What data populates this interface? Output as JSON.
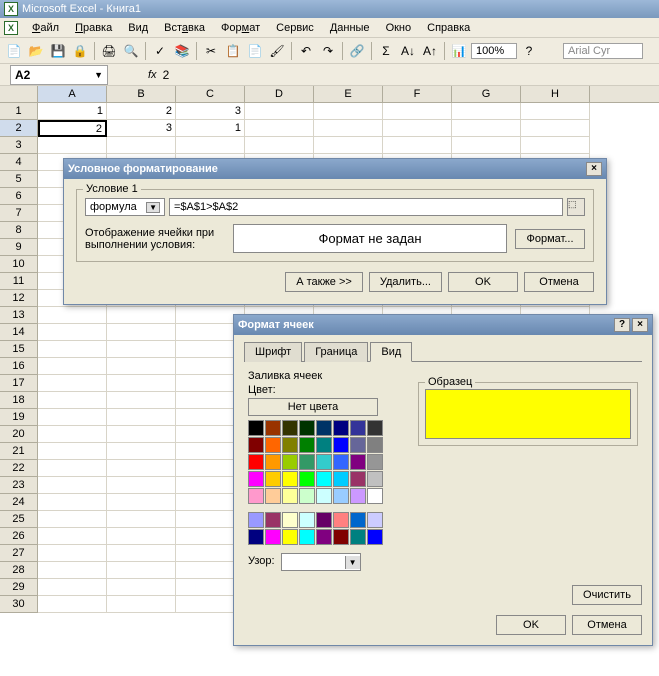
{
  "app": {
    "title": "Microsoft Excel - Книга1"
  },
  "menu": {
    "file": "Файл",
    "edit": "Правка",
    "view": "Вид",
    "insert": "Вставка",
    "format": "Формат",
    "tools": "Сервис",
    "data": "Данные",
    "window": "Окно",
    "help": "Справка"
  },
  "toolbar": {
    "zoom": "100%",
    "font": "Arial Cyr"
  },
  "namebox": {
    "ref": "A2",
    "fx": "fx",
    "formula": "2"
  },
  "columns": [
    "A",
    "B",
    "C",
    "D",
    "E",
    "F",
    "G",
    "H"
  ],
  "rows": [
    "1",
    "2",
    "3",
    "4",
    "5",
    "6",
    "7",
    "8",
    "9",
    "10",
    "11",
    "12",
    "13",
    "14",
    "15",
    "16",
    "17",
    "18",
    "19",
    "20",
    "21",
    "22",
    "23",
    "24",
    "25",
    "26",
    "27",
    "28",
    "29",
    "30"
  ],
  "cells": {
    "A1": "1",
    "B1": "2",
    "C1": "3",
    "A2": "2",
    "B2": "3",
    "C2": "1"
  },
  "cf_dialog": {
    "title": "Условное форматирование",
    "group": "Условие 1",
    "dropdown": "формула",
    "formula": "=$A$1>$A$2",
    "display_label": "Отображение ячейки при выполнении условия:",
    "preview": "Формат не задан",
    "format_btn": "Формат...",
    "also_btn": "А также >>",
    "delete_btn": "Удалить...",
    "ok_btn": "OK",
    "cancel_btn": "Отмена"
  },
  "fc_dialog": {
    "title": "Формат ячеек",
    "tab_font": "Шрифт",
    "tab_border": "Граница",
    "tab_view": "Вид",
    "fill_label": "Заливка ячеек",
    "color_label": "Цвет:",
    "nocolor": "Нет цвета",
    "pattern_label": "Узор:",
    "sample_label": "Образец",
    "sample_color": "#ffff00",
    "clear_btn": "Очистить",
    "ok_btn": "OK",
    "cancel_btn": "Отмена"
  },
  "palette1": [
    "#000000",
    "#993300",
    "#333300",
    "#003300",
    "#003366",
    "#000080",
    "#333399",
    "#333333",
    "#800000",
    "#ff6600",
    "#808000",
    "#008000",
    "#008080",
    "#0000ff",
    "#666699",
    "#808080",
    "#ff0000",
    "#ff9900",
    "#99cc00",
    "#339966",
    "#33cccc",
    "#3366ff",
    "#800080",
    "#969696",
    "#ff00ff",
    "#ffcc00",
    "#ffff00",
    "#00ff00",
    "#00ffff",
    "#00ccff",
    "#993366",
    "#c0c0c0",
    "#ff99cc",
    "#ffcc99",
    "#ffff99",
    "#ccffcc",
    "#ccffff",
    "#99ccff",
    "#cc99ff",
    "#ffffff"
  ],
  "palette2": [
    "#9999ff",
    "#993366",
    "#ffffcc",
    "#ccffff",
    "#660066",
    "#ff8080",
    "#0066cc",
    "#ccccff",
    "#000080",
    "#ff00ff",
    "#ffff00",
    "#00ffff",
    "#800080",
    "#800000",
    "#008080",
    "#0000ff"
  ]
}
